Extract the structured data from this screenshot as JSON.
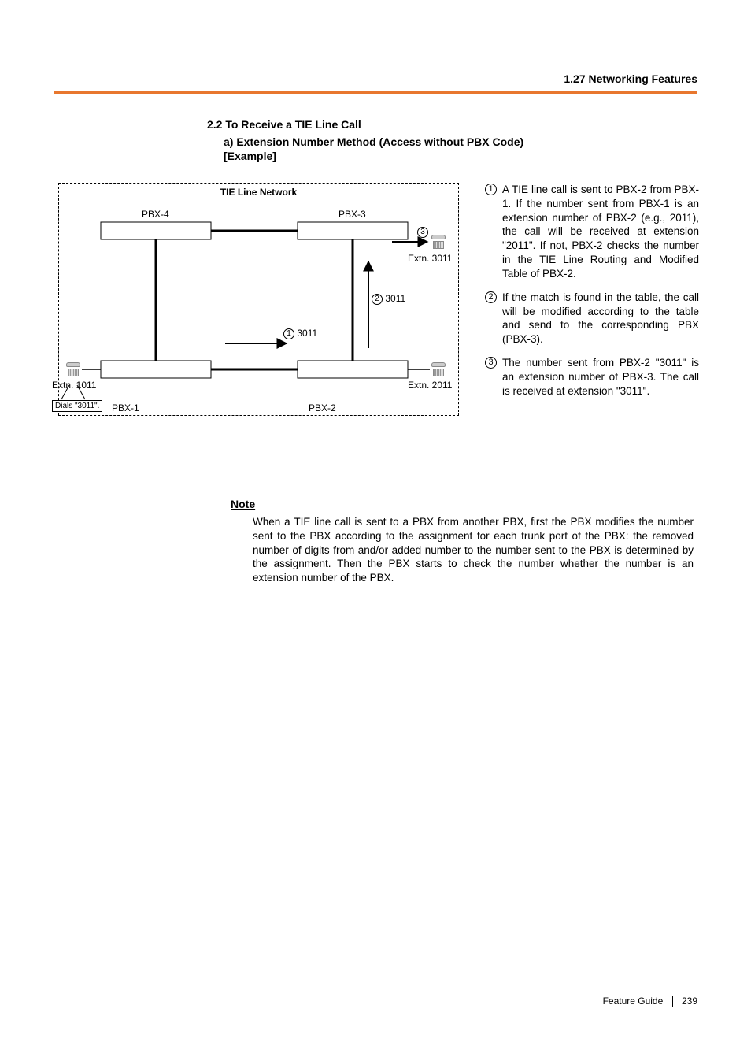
{
  "header": {
    "section": "1.27 Networking Features"
  },
  "headings": {
    "h22": "2.2 To Receive a TIE Line Call",
    "h22a": "a) Extension Number Method (Access without PBX Code)",
    "h22b": "[Example]"
  },
  "diagram": {
    "network_title": "TIE Line Network",
    "pbx4": "PBX-4",
    "pbx3": "PBX-3",
    "pbx1": "PBX-1",
    "pbx2": "PBX-2",
    "extn3011": "Extn. 3011",
    "extn1011": "Extn. 1011",
    "extn2011": "Extn. 2011",
    "dials": "Dials \"3011\".",
    "step1_num": "1",
    "step1_val": "3011",
    "step2_num": "2",
    "step2_val": "3011",
    "step3_num": "3"
  },
  "explain": {
    "items": [
      {
        "num": "1",
        "text": "A TIE line call is sent to PBX-2 from PBX-1. If the number sent from PBX-1 is an extension number of PBX-2 (e.g., 2011), the call will be received at extension \"2011\". If not, PBX-2 checks the number in the TIE Line Routing and Modified Table of PBX-2."
      },
      {
        "num": "2",
        "text": "If the match is found in the table, the call will be modified according to the table and send to the corresponding PBX (PBX-3)."
      },
      {
        "num": "3",
        "text": "The number sent from PBX-2 \"3011\" is an extension number of PBX-3. The call is received at extension \"3011\"."
      }
    ]
  },
  "note": {
    "heading": "Note",
    "body": "When a TIE line call is sent to a PBX from another PBX, first the PBX modifies the number sent to the PBX according to the assignment for each trunk port of the PBX: the removed number of digits from and/or added number to the number sent to the PBX is determined by the assignment. Then the PBX starts to check the number whether the number is an extension number of the PBX."
  },
  "footer": {
    "guide": "Feature Guide",
    "page": "239"
  }
}
